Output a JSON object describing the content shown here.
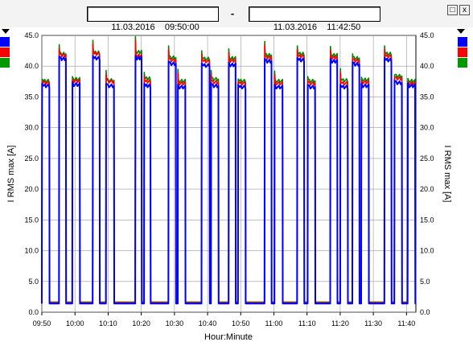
{
  "header": {
    "start_date": "11.03.2016",
    "start_time": "09:50:00",
    "separator": "-",
    "end_date": "11.03.2016",
    "end_time": "11:42:50",
    "restore_glyph": "□",
    "close_glyph": "x"
  },
  "legend_swatches": [
    "#0000ff",
    "#ff0000",
    "#009900"
  ],
  "chart_data": {
    "type": "line",
    "xlabel": "Hour:Minute",
    "ylabel_left": "I RMS max [A]",
    "ylabel_right": "I RMS max [A]",
    "xlim": [
      "09:50",
      "11:42:50"
    ],
    "ylim": [
      0,
      45
    ],
    "x_ticks": [
      "09:50",
      "10:00",
      "10:10",
      "10:20",
      "10:30",
      "10:40",
      "10:50",
      "11:00",
      "11:10",
      "11:20",
      "11:30",
      "11:40"
    ],
    "y_ticks": [
      "0.0",
      "5.0",
      "10.0",
      "15.0",
      "20.0",
      "25.0",
      "30.0",
      "35.0",
      "40.0",
      "45.0"
    ],
    "grid": true,
    "series_colors": [
      "#008800",
      "#ff0000",
      "#0000ff"
    ],
    "baseline_level": 1.5,
    "pulses": [
      {
        "start": "09:50:00",
        "end": "09:52:20",
        "levels": [
          37.6,
          37.3,
          36.8
        ],
        "peak": 37.8
      },
      {
        "start": "09:55:10",
        "end": "09:57:20",
        "levels": [
          42.0,
          41.8,
          41.2
        ],
        "peak": 43.5
      },
      {
        "start": "09:59:10",
        "end": "10:01:30",
        "levels": [
          37.9,
          37.6,
          37.0
        ],
        "peak": 38.3
      },
      {
        "start": "10:05:20",
        "end": "10:07:30",
        "levels": [
          42.2,
          42.0,
          41.3
        ],
        "peak": 44.2
      },
      {
        "start": "10:09:20",
        "end": "10:11:50",
        "levels": [
          37.7,
          37.5,
          36.8
        ],
        "peak": 39.3
      },
      {
        "start": "10:18:10",
        "end": "10:20:10",
        "levels": [
          42.3,
          41.7,
          41.3
        ],
        "peak": 44.8
      },
      {
        "start": "10:20:50",
        "end": "10:22:50",
        "levels": [
          38.0,
          37.5,
          36.8
        ],
        "peak": 39.0
      },
      {
        "start": "10:28:10",
        "end": "10:30:30",
        "levels": [
          41.4,
          41.0,
          40.4
        ],
        "peak": 43.3
      },
      {
        "start": "10:31:00",
        "end": "10:33:20",
        "levels": [
          37.6,
          37.2,
          36.6
        ],
        "peak": 39.5
      },
      {
        "start": "10:38:10",
        "end": "10:40:40",
        "levels": [
          41.2,
          40.8,
          40.1
        ],
        "peak": 42.5
      },
      {
        "start": "10:41:00",
        "end": "10:43:20",
        "levels": [
          37.9,
          37.4,
          36.8
        ],
        "peak": 39.3
      },
      {
        "start": "10:46:20",
        "end": "10:48:30",
        "levels": [
          41.3,
          40.9,
          40.2
        ],
        "peak": 42.8
      },
      {
        "start": "10:49:10",
        "end": "10:51:30",
        "levels": [
          37.6,
          37.2,
          36.6
        ],
        "peak": 37.9
      },
      {
        "start": "10:57:10",
        "end": "10:59:20",
        "levels": [
          41.8,
          41.4,
          40.8
        ],
        "peak": 44.0
      },
      {
        "start": "11:00:10",
        "end": "11:02:40",
        "levels": [
          37.6,
          37.2,
          36.6
        ],
        "peak": 39.2
      },
      {
        "start": "11:07:00",
        "end": "11:09:10",
        "levels": [
          42.0,
          41.6,
          41.0
        ],
        "peak": 43.3
      },
      {
        "start": "11:10:10",
        "end": "11:12:30",
        "levels": [
          37.6,
          37.2,
          36.6
        ],
        "peak": 38.3
      },
      {
        "start": "11:17:00",
        "end": "11:19:10",
        "levels": [
          41.8,
          41.4,
          40.8
        ],
        "peak": 43.2
      },
      {
        "start": "11:20:00",
        "end": "11:22:20",
        "levels": [
          37.7,
          37.2,
          36.6
        ],
        "peak": 39.6
      },
      {
        "start": "11:23:40",
        "end": "11:25:50",
        "levels": [
          41.3,
          40.9,
          40.3
        ],
        "peak": 42.0
      },
      {
        "start": "11:26:20",
        "end": "11:28:40",
        "levels": [
          37.8,
          37.4,
          36.8
        ],
        "peak": 38.2
      },
      {
        "start": "11:33:20",
        "end": "11:35:30",
        "levels": [
          42.0,
          41.6,
          41.0
        ],
        "peak": 43.3
      },
      {
        "start": "11:36:20",
        "end": "11:38:40",
        "levels": [
          38.4,
          38.0,
          37.3
        ],
        "peak": 38.5
      },
      {
        "start": "11:40:20",
        "end": "11:42:40",
        "levels": [
          37.6,
          37.2,
          36.8
        ],
        "peak": 38.0
      }
    ]
  }
}
